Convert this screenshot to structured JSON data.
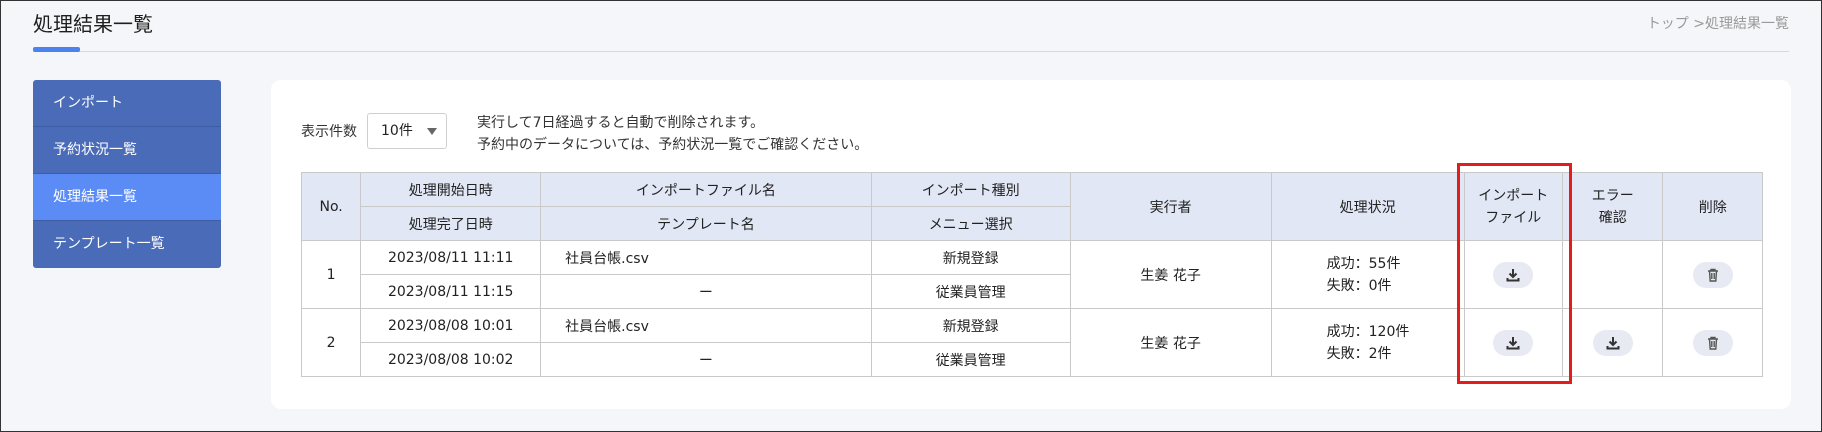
{
  "page": {
    "title": "処理結果一覧",
    "breadcrumb": "トップ >処理結果一覧"
  },
  "sidebar": {
    "items": [
      {
        "label": "インポート",
        "active": false
      },
      {
        "label": "予約状況一覧",
        "active": false
      },
      {
        "label": "処理結果一覧",
        "active": true
      },
      {
        "label": "テンプレート一覧",
        "active": false
      }
    ]
  },
  "controls": {
    "display_count_label": "表示件数",
    "display_count_value": "10件",
    "notice_line1": "実行して7日経過すると自動で削除されます。",
    "notice_line2": "予約中のデータについては、予約状況一覧でご確認ください。"
  },
  "table": {
    "headers": {
      "no": "No.",
      "start": "処理開始日時",
      "end": "処理完了日時",
      "file": "インポートファイル名",
      "template": "テンプレート名",
      "type": "インポート種別",
      "menu": "メニュー選択",
      "executor": "実行者",
      "status": "処理状況",
      "import_file_1": "インポート",
      "import_file_2": "ファイル",
      "error_1": "エラー",
      "error_2": "確認",
      "delete": "削除"
    },
    "rows": [
      {
        "no": "1",
        "start": "2023/08/11 11:11",
        "end": "2023/08/11 11:15",
        "file": "社員台帳.csv",
        "template": "ー",
        "type": "新規登録",
        "menu": "従業員管理",
        "executor": "生姜 花子",
        "success": "成功：55件",
        "fail": "失敗：0件"
      },
      {
        "no": "2",
        "start": "2023/08/08 10:01",
        "end": "2023/08/08 10:02",
        "file": "社員台帳.csv",
        "template": "ー",
        "type": "新規登録",
        "menu": "従業員管理",
        "executor": "生姜 花子",
        "success": "成功：120件",
        "fail": "失敗：2件"
      }
    ]
  },
  "colors": {
    "sidebar": "#4a6bb8",
    "sidebar_active": "#5b8bf5",
    "table_header": "#e1e7f5",
    "highlight": "#e31c1c"
  }
}
